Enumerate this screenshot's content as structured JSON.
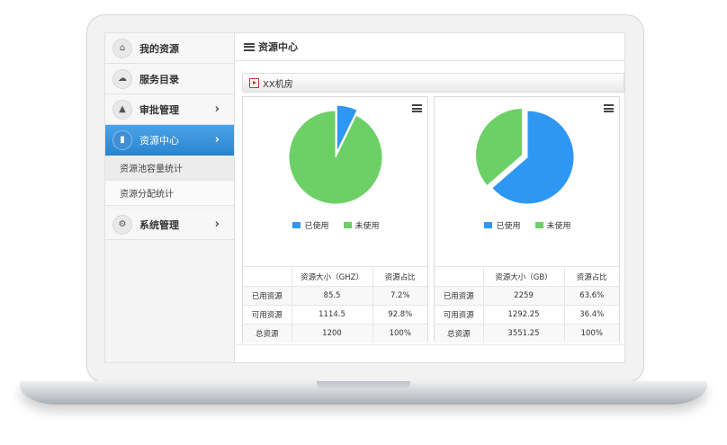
{
  "sidebar": {
    "items": [
      {
        "label": "我的资源",
        "icon": "home-icon"
      },
      {
        "label": "服务目录",
        "icon": "cloud-icon"
      },
      {
        "label": "审批管理",
        "icon": "sitemap-icon"
      },
      {
        "label": "资源中心",
        "icon": "bar-chart-icon"
      },
      {
        "label": "系统管理",
        "icon": "gears-icon"
      }
    ],
    "subitems": [
      "资源池容量统计",
      "资源分配统计"
    ]
  },
  "header": {
    "title": "资源中心"
  },
  "section": {
    "title": "XX机房"
  },
  "colors": {
    "used": "#2e97f3",
    "unused": "#6cd066",
    "accent": "#3a93dc"
  },
  "legend": {
    "used": "已使用",
    "unused": "未使用"
  },
  "cards": [
    {
      "table": {
        "headers": [
          "",
          "资源大小（GHZ）",
          "资源占比"
        ],
        "rows": [
          [
            "已用资源",
            "85.5",
            "7.2%"
          ],
          [
            "可用资源",
            "1114.5",
            "92.8%"
          ],
          [
            "总资源",
            "1200",
            "100%"
          ]
        ]
      }
    },
    {
      "table": {
        "headers": [
          "",
          "资源大小（GB）",
          "资源占比"
        ],
        "rows": [
          [
            "已用资源",
            "2259",
            "63.6%"
          ],
          [
            "可用资源",
            "1292.25",
            "36.4%"
          ],
          [
            "总资源",
            "3551.25",
            "100%"
          ]
        ]
      }
    }
  ],
  "chart_data": [
    {
      "type": "pie",
      "categories": [
        "已使用",
        "未使用"
      ],
      "values": [
        7.2,
        92.8
      ],
      "colors": [
        "#2e97f3",
        "#6cd066"
      ],
      "exploded": "已使用"
    },
    {
      "type": "pie",
      "categories": [
        "已使用",
        "未使用"
      ],
      "values": [
        63.6,
        36.4
      ],
      "colors": [
        "#2e97f3",
        "#6cd066"
      ],
      "exploded": "未使用"
    }
  ]
}
